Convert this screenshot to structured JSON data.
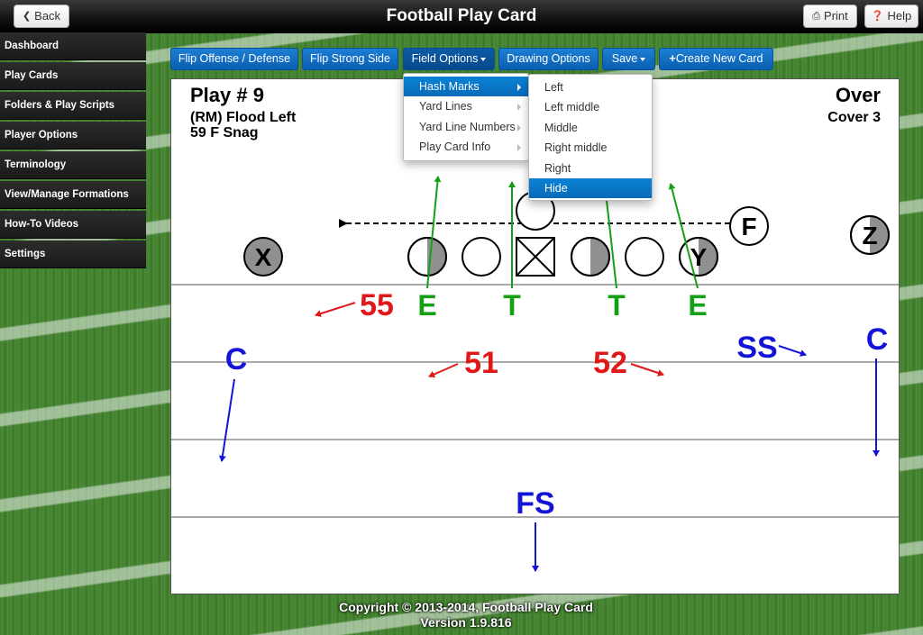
{
  "header": {
    "title": "Football Play Card",
    "back_label": "Back",
    "print_label": "Print",
    "help_label": "Help"
  },
  "sidebar": {
    "items": [
      {
        "label": "Dashboard"
      },
      {
        "label": "Play Cards"
      },
      {
        "label": "Folders & Play Scripts"
      },
      {
        "label": "Player Options"
      },
      {
        "label": "Terminology"
      },
      {
        "label": "View/Manage Formations"
      },
      {
        "label": "How-To Videos"
      },
      {
        "label": "Settings"
      }
    ]
  },
  "toolbar": {
    "flip_offense": "Flip Offense / Defense",
    "flip_strong": "Flip Strong Side",
    "field_options": "Field Options",
    "drawing_options": "Drawing Options",
    "save": "Save",
    "create_new": "Create New Card"
  },
  "field_menu": {
    "items": [
      {
        "label": "Hash Marks"
      },
      {
        "label": "Yard Lines"
      },
      {
        "label": "Yard Line Numbers"
      },
      {
        "label": "Play Card Info"
      }
    ]
  },
  "hash_menu": {
    "items": [
      {
        "label": "Left"
      },
      {
        "label": "Left middle"
      },
      {
        "label": "Middle"
      },
      {
        "label": "Right middle"
      },
      {
        "label": "Right"
      },
      {
        "label": "Hide"
      }
    ]
  },
  "card": {
    "play_number": "Play # 9",
    "play_name": "(RM) Flood Left",
    "play_call": "59 F Snag",
    "defense_front": "Over",
    "defense_coverage": "Cover 3",
    "offense_players": [
      {
        "label": "X"
      },
      {
        "label": "F"
      },
      {
        "label": "Z"
      },
      {
        "label": "Y"
      }
    ],
    "defense_players": [
      {
        "label": "E"
      },
      {
        "label": "T"
      },
      {
        "label": "T"
      },
      {
        "label": "E"
      },
      {
        "label": "55"
      },
      {
        "label": "51"
      },
      {
        "label": "52"
      },
      {
        "label": "SS"
      },
      {
        "label": "C"
      },
      {
        "label": "C"
      },
      {
        "label": "FS"
      }
    ]
  },
  "colors": {
    "dl_green": "#14a014",
    "lb_red": "#e01818",
    "db_blue": "#1414d8",
    "menu_highlight": "#0a78cc",
    "toolbar_blue": "#0d6bc4"
  },
  "footer": {
    "copyright": "Copyright © 2013-2014, Football Play Card",
    "version": "Version 1.9.816"
  }
}
